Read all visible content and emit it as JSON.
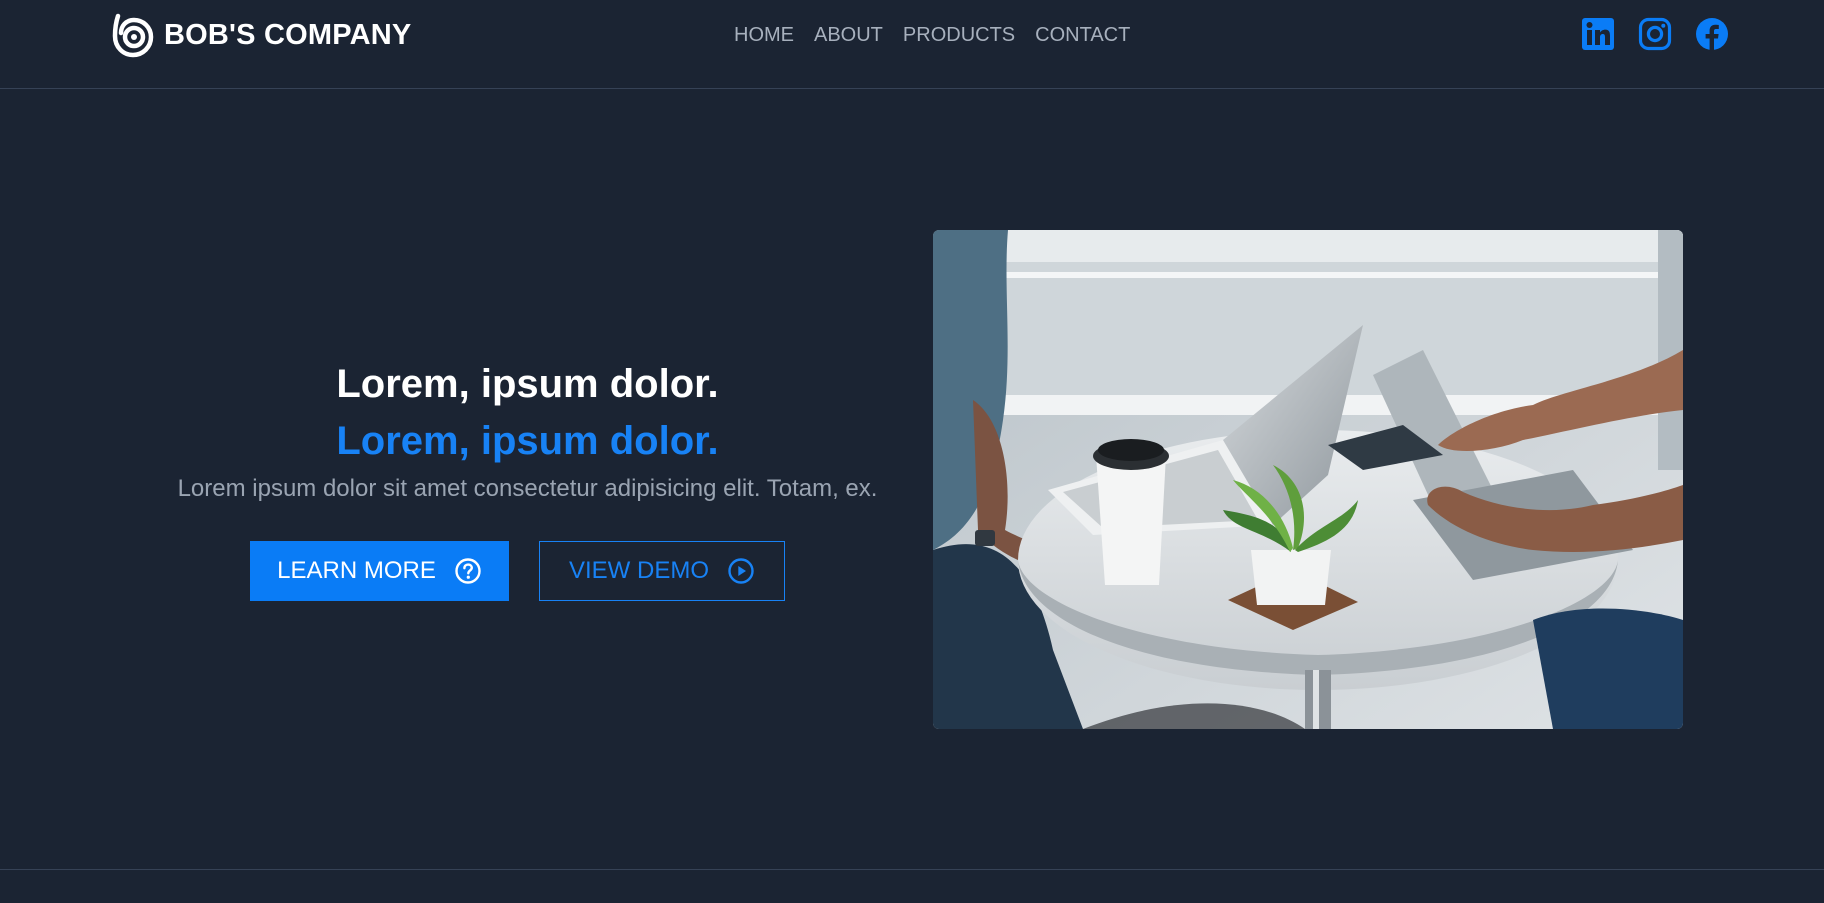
{
  "navbar": {
    "brand_name": "BOB'S COMPANY",
    "logo_icon": "swirl-logo-icon",
    "links": [
      {
        "label": "HOME"
      },
      {
        "label": "ABOUT"
      },
      {
        "label": "PRODUCTS"
      },
      {
        "label": "CONTACT"
      }
    ],
    "social": [
      {
        "name": "linkedin-icon"
      },
      {
        "name": "instagram-icon"
      },
      {
        "name": "facebook-icon"
      }
    ]
  },
  "hero": {
    "title": "Lorem, ipsum dolor.",
    "subtitle": "Lorem, ipsum dolor.",
    "description": "Lorem ipsum dolor sit amet consectetur adipisicing elit. Totam, ex.",
    "primary_button": {
      "label": "LEARN MORE",
      "icon": "question-circle-icon"
    },
    "secondary_button": {
      "label": "VIEW DEMO",
      "icon": "play-circle-icon"
    },
    "image_subject": "two people working with laptops at a round cafe table"
  },
  "colors": {
    "background": "#1b2433",
    "accent": "#0a7cf6",
    "muted_text": "#9aa4b2",
    "divider": "#364256"
  }
}
